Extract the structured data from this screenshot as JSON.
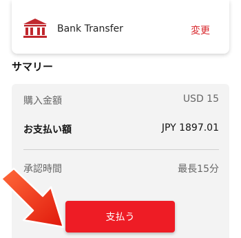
{
  "payment_method": {
    "icon": "bank-icon",
    "label": "Bank Transfer",
    "change_label": "変更"
  },
  "summary": {
    "title": "サマリー",
    "rows": [
      {
        "label": "購入金額",
        "value": "USD 15"
      },
      {
        "label": "お支払い額",
        "value": "JPY 1897.01"
      },
      {
        "label": "承認時間",
        "value": "最長15分"
      }
    ]
  },
  "actions": {
    "pay_label": "支払う"
  },
  "colors": {
    "accent": "#ee1c25",
    "link": "#d8262b",
    "summary_bg": "#f3f3f3"
  }
}
